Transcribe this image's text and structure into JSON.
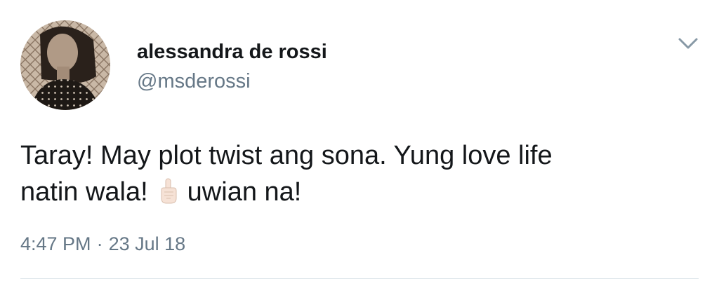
{
  "author": {
    "name": "alessandra de rossi",
    "handle": "@msderossi"
  },
  "tweet": {
    "line1": "Taray! May plot twist ang sona. Yung love life",
    "line2_before_emoji": "natin wala!",
    "emoji": "raised-index-finger-emoji",
    "line2_after_emoji": "uwian na!",
    "time": "4:47 PM",
    "separator": "·",
    "date": "23 Jul 18"
  },
  "icons": {
    "menu": "chevron-down-icon"
  },
  "colors": {
    "text": "#14171a",
    "secondary_text": "#657786",
    "divider": "#e1e8ed"
  }
}
